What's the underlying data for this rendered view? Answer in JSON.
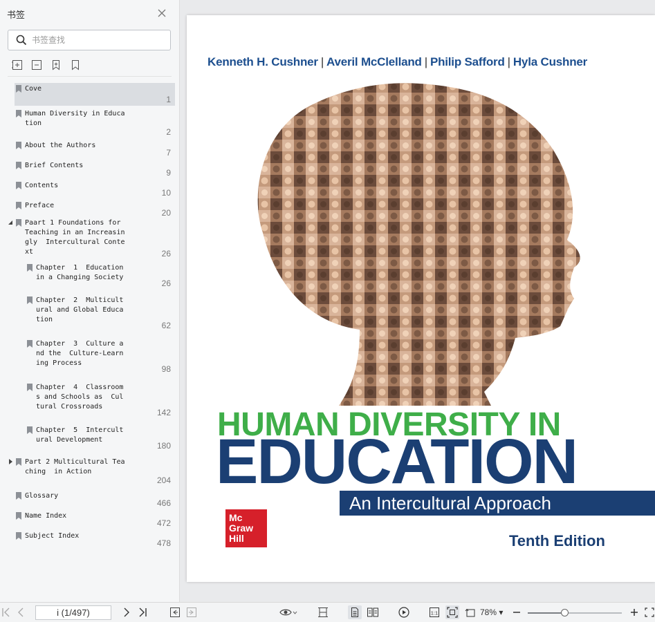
{
  "sidebar": {
    "title": "书签",
    "search_placeholder": "书签查找",
    "bookmarks": [
      {
        "label": "Cove",
        "page": "1",
        "level": 0,
        "selected": true,
        "expander": ""
      },
      {
        "label": "Human Diversity in Educa\ntion",
        "page": "2",
        "level": 0,
        "selected": false,
        "expander": ""
      },
      {
        "label": "About the Authors",
        "page": "7",
        "level": 0,
        "selected": false,
        "expander": ""
      },
      {
        "label": "Brief Contents",
        "page": "9",
        "level": 0,
        "selected": false,
        "expander": ""
      },
      {
        "label": "Contents",
        "page": "10",
        "level": 0,
        "selected": false,
        "expander": ""
      },
      {
        "label": "Preface",
        "page": "20",
        "level": 0,
        "selected": false,
        "expander": ""
      },
      {
        "label": "Paart 1 Foundations for\nTeaching in an Increasin\ngly  Intercultural Conte\nxt",
        "page": "26",
        "level": 0,
        "selected": false,
        "expander": "expanded"
      },
      {
        "label": "Chapter  1  Education\nin a Changing Society",
        "page": "26",
        "level": 1,
        "selected": false,
        "expander": ""
      },
      {
        "label": "Chapter  2  Multicult\nural and Global Educa\ntion",
        "page": "62",
        "level": 1,
        "selected": false,
        "expander": ""
      },
      {
        "label": "Chapter  3  Culture a\nnd the  Culture-Learn\ning Process",
        "page": "98",
        "level": 1,
        "selected": false,
        "expander": ""
      },
      {
        "label": "Chapter  4  Classroom\ns and Schools as  Cul\ntural Crossroads",
        "page": "142",
        "level": 1,
        "selected": false,
        "expander": ""
      },
      {
        "label": "Chapter  5  Intercult\nural Development",
        "page": "180",
        "level": 1,
        "selected": false,
        "expander": ""
      },
      {
        "label": "Part 2 Multicultural Tea\nching  in Action",
        "page": "204",
        "level": 0,
        "selected": false,
        "expander": "collapsed"
      },
      {
        "label": "Glossary",
        "page": "466",
        "level": 0,
        "selected": false,
        "expander": ""
      },
      {
        "label": "Name Index",
        "page": "472",
        "level": 0,
        "selected": false,
        "expander": ""
      },
      {
        "label": "Subject Index",
        "page": "478",
        "level": 0,
        "selected": false,
        "expander": ""
      }
    ]
  },
  "cover": {
    "authors": [
      "Kenneth H. Cushner",
      "Averil McClelland",
      "Philip Safford",
      "Hyla Cushner"
    ],
    "title_line1": "HUMAN DIVERSITY IN",
    "title_line2": "EDUCATION",
    "subtitle": "An Intercultural Approach",
    "publisher_lines": [
      "Mc",
      "Graw",
      "Hill"
    ],
    "edition": "Tenth Edition",
    "colors": {
      "green": "#3fae49",
      "navy": "#1b3f73",
      "author_blue": "#1d4f8f",
      "publisher_red": "#d6202a"
    }
  },
  "toolbar": {
    "page_indicator": "i (1/497)",
    "zoom": "78%",
    "zoom_fraction": 0.4
  }
}
